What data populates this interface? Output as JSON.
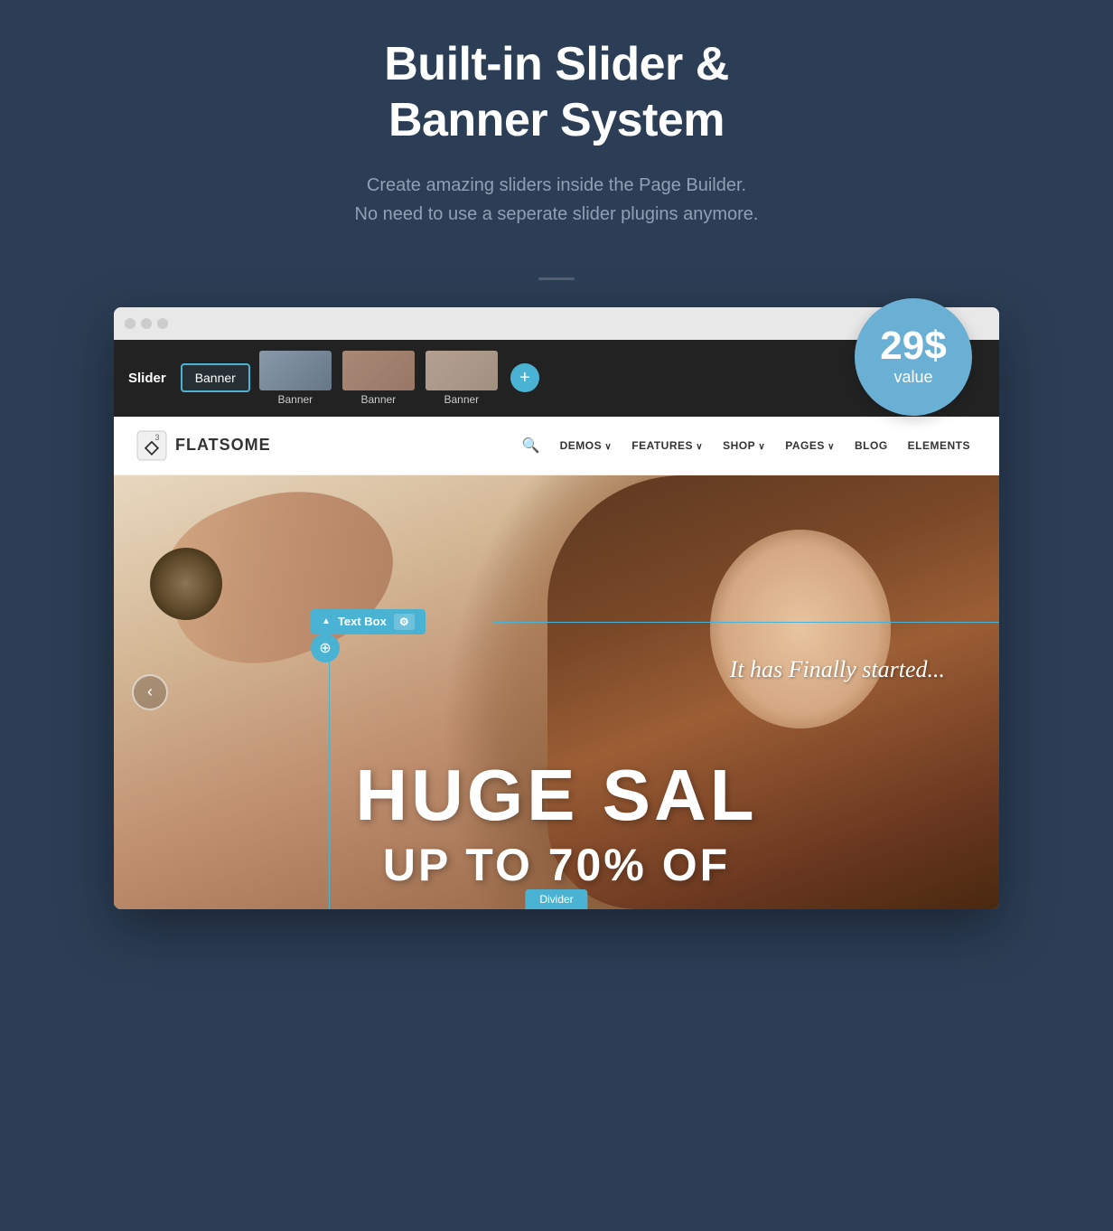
{
  "header": {
    "title_line1": "Built-in Slider &",
    "title_line2": "Banner System",
    "subtitle_line1": "Create amazing sliders inside the Page Builder.",
    "subtitle_line2": "No need to use a seperate slider plugins anymore."
  },
  "value_badge": {
    "price": "29$",
    "label": "value"
  },
  "slider_toolbar": {
    "slider_label": "Slider",
    "tabs": [
      {
        "label": "Banner",
        "active": true,
        "has_thumb": false
      },
      {
        "label": "Banner",
        "active": false,
        "has_thumb": true
      },
      {
        "label": "Banner",
        "active": false,
        "has_thumb": true
      },
      {
        "label": "Banner",
        "active": false,
        "has_thumb": true
      }
    ],
    "add_button_label": "+"
  },
  "site_header": {
    "logo_text": "FLATSOME",
    "logo_version": "3",
    "nav_items": [
      {
        "label": "DEMOS",
        "has_arrow": true
      },
      {
        "label": "FEATURES",
        "has_arrow": true
      },
      {
        "label": "SHOP",
        "has_arrow": true
      },
      {
        "label": "PAGES",
        "has_arrow": true
      },
      {
        "label": "BLOG",
        "has_arrow": false
      },
      {
        "label": "ELEMENTS",
        "has_arrow": false
      }
    ]
  },
  "hero": {
    "text_box_label": "Text Box",
    "italic_text": "It has Finally started...",
    "huge_sale_text": "HUGE SAL",
    "up_to_text": "UP TO 70% OF",
    "prev_btn": "‹",
    "divider_label": "Divider"
  }
}
